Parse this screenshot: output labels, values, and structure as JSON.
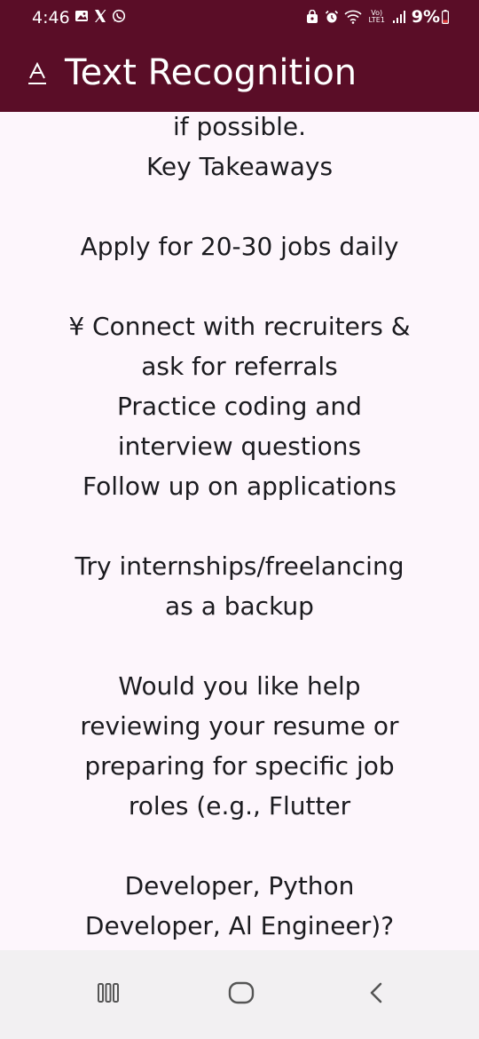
{
  "status_bar": {
    "time": "4:46",
    "left_icons": [
      "gallery-icon",
      "x-app-icon",
      "whatsapp-icon"
    ],
    "right_icons": [
      "lock-icon",
      "alarm-icon",
      "wifi-icon",
      "volte-icon",
      "signal-icon"
    ],
    "volte_text": "Vo) LTE1",
    "battery": "9%",
    "battery_color": "#e53935"
  },
  "app_bar": {
    "icon": "text-recognition-icon",
    "title": "Text Recognition",
    "background_color": "#5a0d27"
  },
  "recognized_text": {
    "lines": [
      "if possible.",
      "Key Takeaways",
      "",
      "Apply for 20-30 jobs daily",
      "",
      "¥ Connect with recruiters &",
      "ask for referrals",
      "Practice coding and",
      "interview questions",
      "Follow up on applications",
      "",
      "Try internships/freelancing",
      "as a backup",
      "",
      "Would you like help",
      "reviewing your resume or",
      "preparing for specific job",
      "roles (e.g., Flutter",
      "",
      "Developer, Python",
      "Developer, Al Engineer)?"
    ]
  },
  "nav_bar": {
    "recents": "recents-icon",
    "home": "home-icon",
    "back": "back-icon"
  }
}
